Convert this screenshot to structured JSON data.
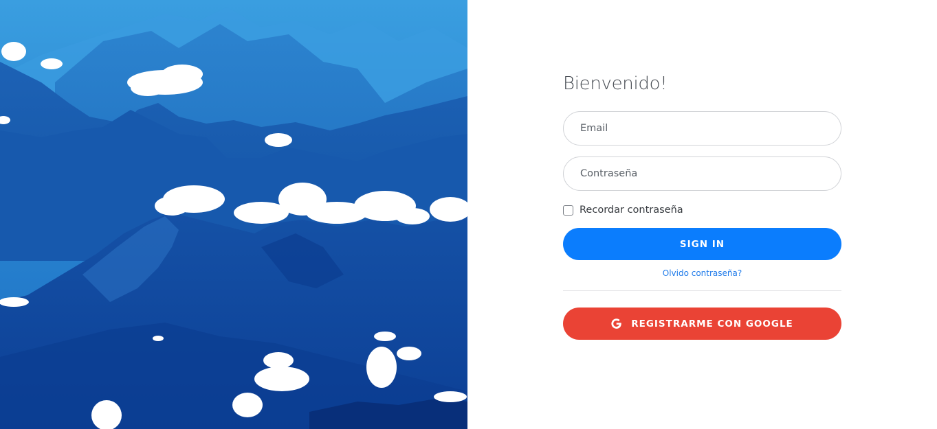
{
  "login": {
    "title": "Bienvenido!",
    "email_placeholder": "Email",
    "password_placeholder": "Contraseña",
    "remember_label": "Recordar contraseña",
    "remember_checked": false,
    "signin_label": "Sign in",
    "forgot_label": "Olvido contraseña?",
    "google_label": "Registrarme con Google",
    "google_icon": "google-g-icon"
  },
  "colors": {
    "primary": "#0b7dfd",
    "google": "#ea4335",
    "link": "#1f7bea",
    "hero_sky": "#2f8fd6",
    "hero_mountain": "#0d4fa8"
  }
}
